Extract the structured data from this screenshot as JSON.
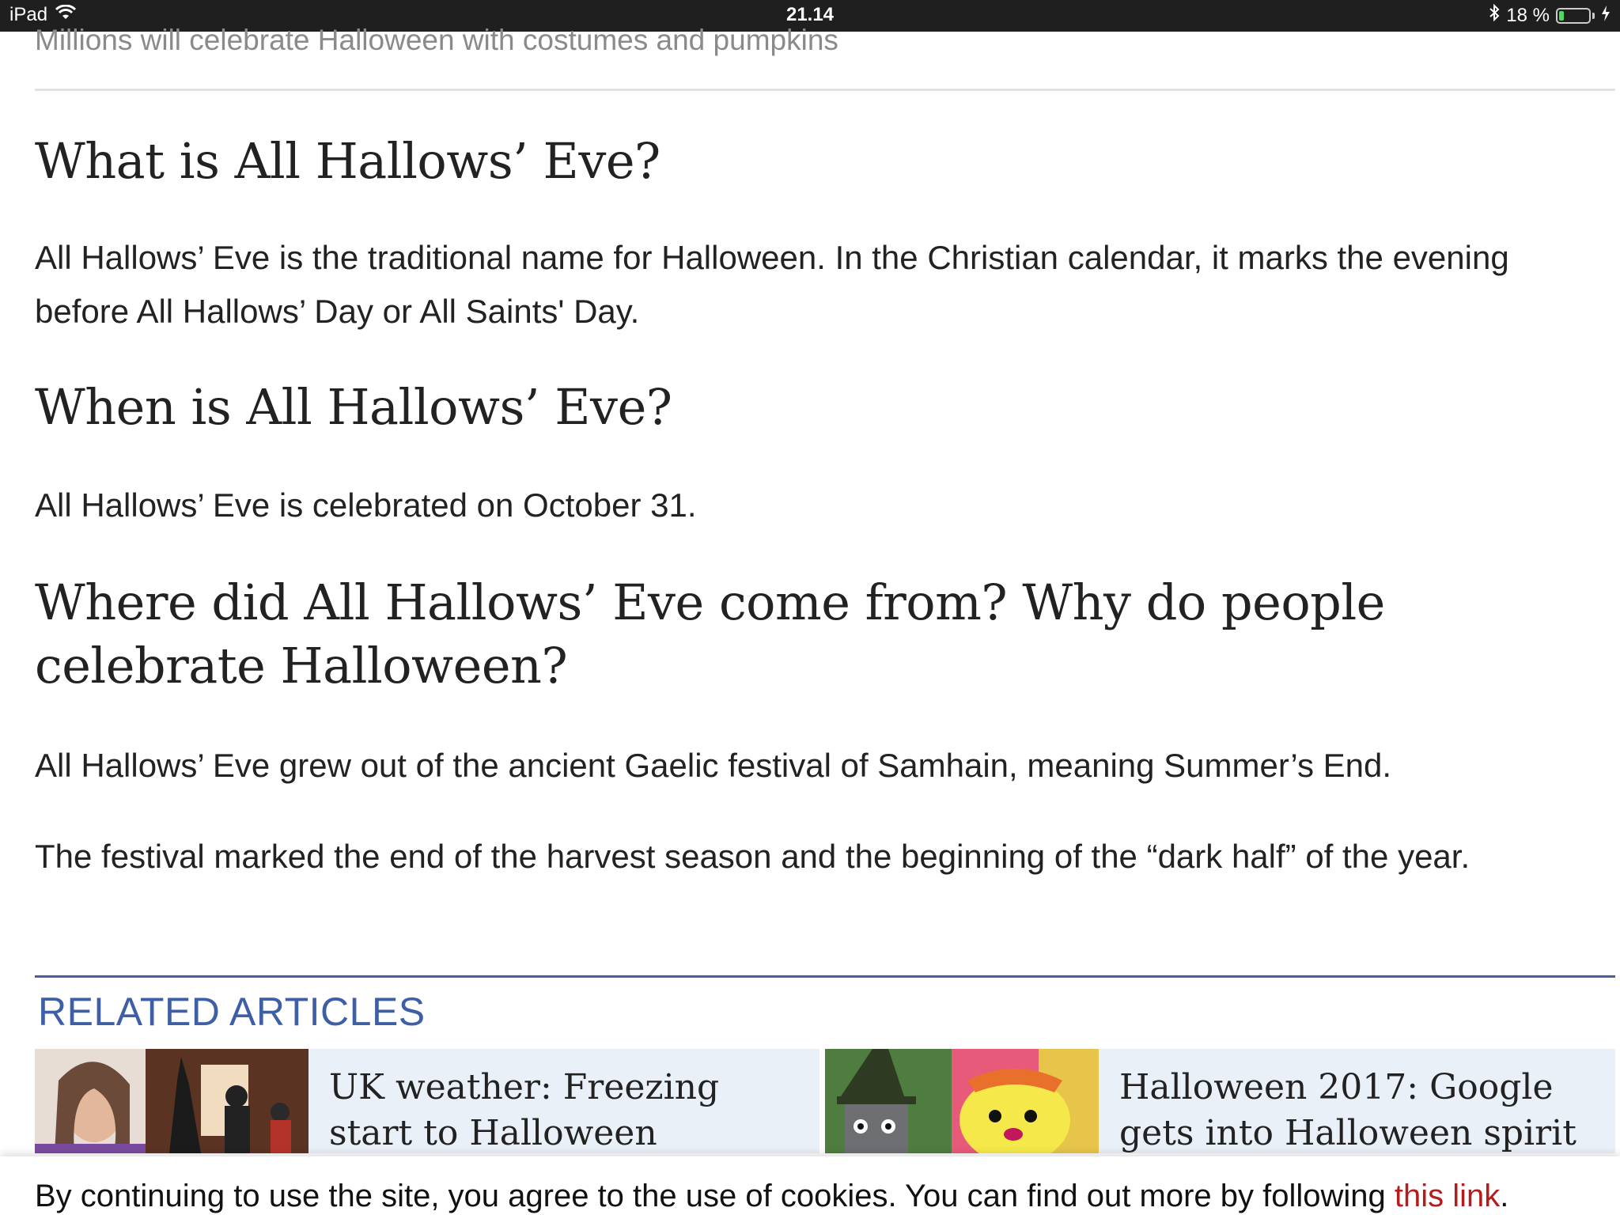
{
  "status_bar": {
    "device": "iPad",
    "time": "21.14",
    "battery_percent": "18 %",
    "battery_level": 0.18,
    "icons": [
      "wifi-icon",
      "bluetooth-icon",
      "battery-icon",
      "charging-icon"
    ]
  },
  "article": {
    "subtitle": "Millions will celebrate Halloween with costumes and pumpkins",
    "sections": [
      {
        "heading": "What is All Hallows’ Eve?",
        "paragraphs": [
          "All Hallows’ Eve is the traditional name for Halloween. In the Christian calendar, it marks the evening before All Hallows’ Day or All Saints' Day."
        ]
      },
      {
        "heading": "When is All Hallows’ Eve?",
        "paragraphs": [
          "All Hallows’ Eve is celebrated on October 31."
        ]
      },
      {
        "heading": "Where did All Hallows’ Eve come from? Why do people celebrate Halloween?",
        "paragraphs": [
          "All Hallows’ Eve grew out of the ancient Gaelic festival of Samhain, meaning Summer’s End.",
          "The festival marked the end of the harvest season and the beginning of the “dark half” of the year."
        ]
      }
    ]
  },
  "related": {
    "title": "RELATED ARTICLES",
    "items": [
      {
        "title": "UK weather: Freezing start to Halloween nationwide"
      },
      {
        "title": "Halloween 2017: Google gets into Halloween spirit"
      }
    ]
  },
  "cookie_banner": {
    "text": "By continuing to use the site, you agree to the use of cookies. You can find out more by following ",
    "link_text": "this link",
    "suffix": "."
  },
  "colors": {
    "related_accent": "#3e5fa6",
    "link_red": "#b01e1e",
    "card_background": "#eaf0f8"
  }
}
